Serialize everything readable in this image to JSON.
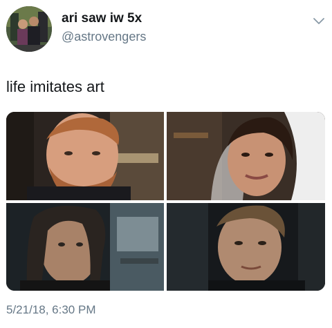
{
  "author": {
    "display_name": "ari saw iw 5x",
    "handle": "@astrovengers"
  },
  "tweet": {
    "text": "life imitates art",
    "timestamp": "5/21/18, 6:30 PM"
  },
  "icons": {
    "avatar": "profile-avatar",
    "menu": "chevron-down-icon"
  },
  "colors": {
    "text_primary": "#14171a",
    "text_secondary": "#657786"
  }
}
